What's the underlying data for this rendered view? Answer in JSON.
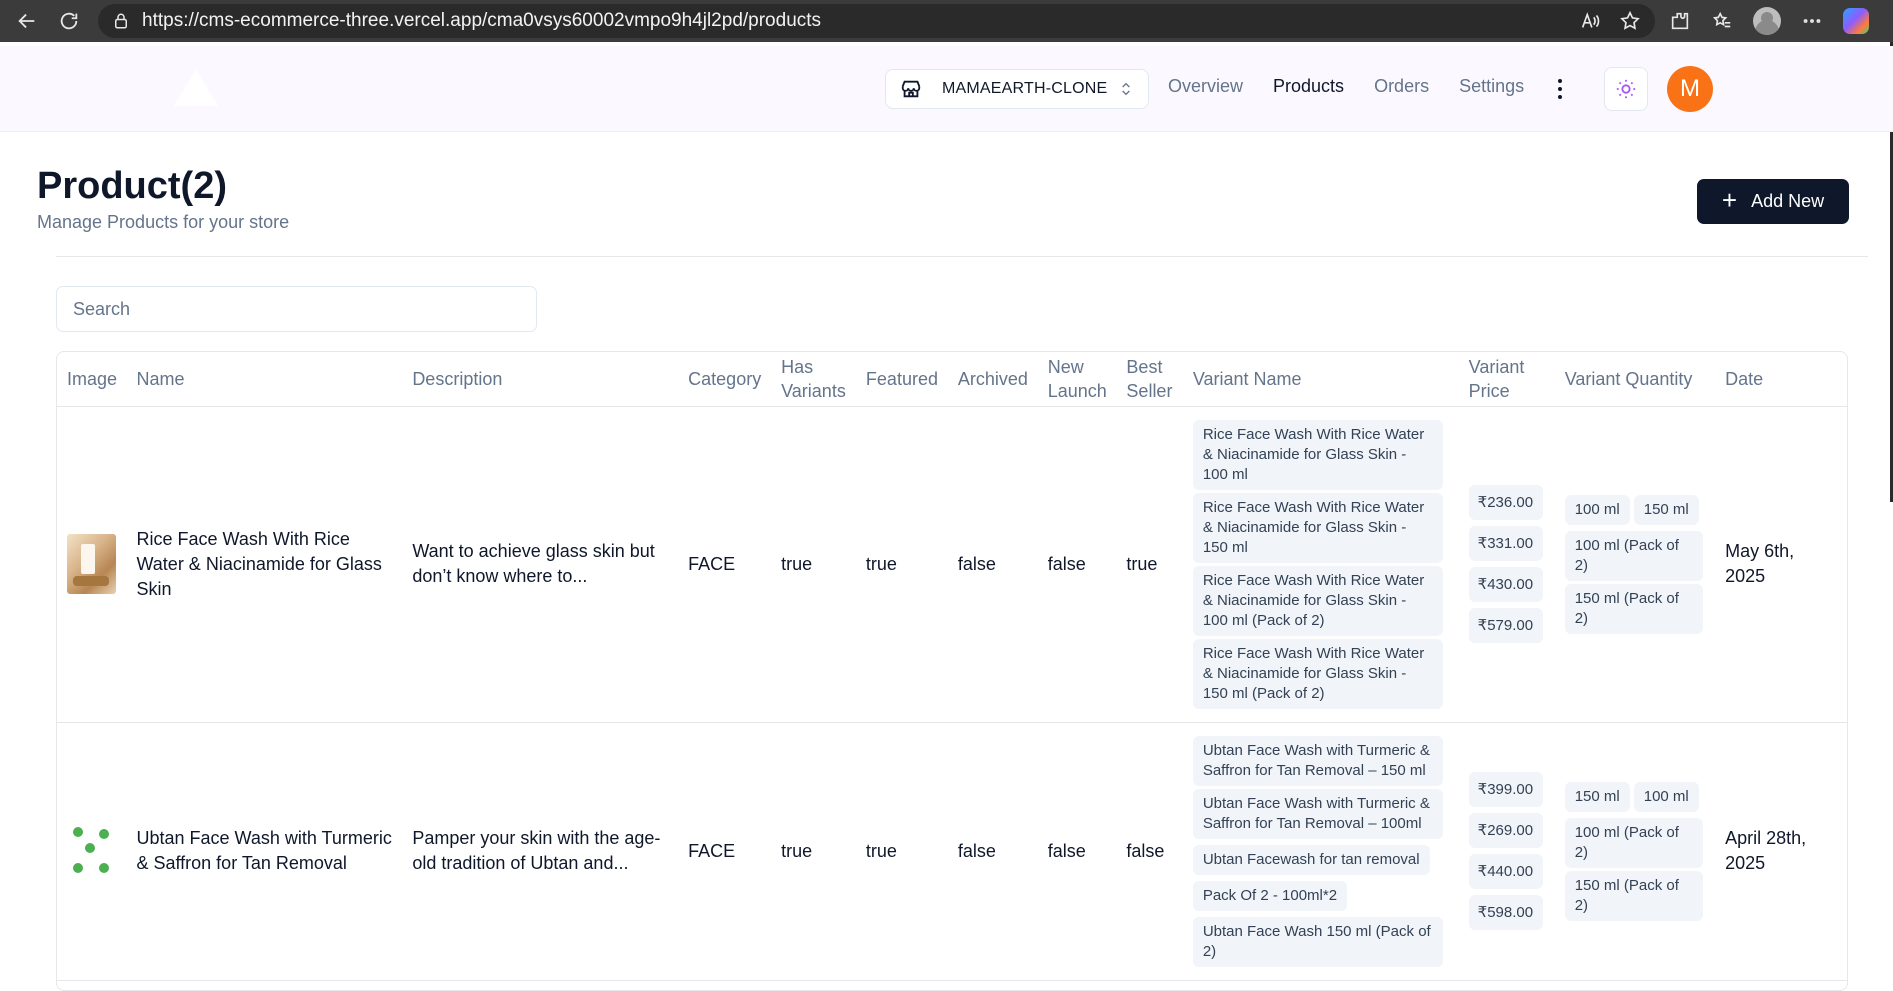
{
  "browser": {
    "url": "https://cms-ecommerce-three.vercel.app/cma0vsys60002vmpo9h4jl2pd/products"
  },
  "header": {
    "store_name": "MAMAEARTH-CLONE",
    "nav": [
      "Overview",
      "Products",
      "Orders",
      "Settings"
    ],
    "active_nav": "Products",
    "avatar_initial": "M",
    "theme_icon": "sun-icon",
    "accent_color": "#f97316"
  },
  "page": {
    "title": "Product(2)",
    "subtitle": "Manage Products for your store",
    "add_button_label": "Add New",
    "search_placeholder": "Search"
  },
  "table": {
    "headers": {
      "image": "Image",
      "name": "Name",
      "description": "Description",
      "category": "Category",
      "has_variants": "Has Variants",
      "featured": "Featured",
      "archived": "Archived",
      "new_launch": "New Launch",
      "best_seller": "Best Seller",
      "variant_name": "Variant Name",
      "variant_price": "Variant Price",
      "variant_quantity": "Variant Quantity",
      "date": "Date"
    },
    "rows": [
      {
        "name": "Rice Face Wash With Rice Water & Niacinamide for Glass Skin",
        "description": "Want to achieve glass skin but don’t know where to...",
        "category": "FACE",
        "has_variants": "true",
        "featured": "true",
        "archived": "false",
        "new_launch": "false",
        "best_seller": "true",
        "variant_names": [
          "Rice Face Wash With Rice Water & Niacinamide for Glass Skin - 100 ml",
          "Rice Face Wash With Rice Water & Niacinamide for Glass Skin - 150 ml",
          "Rice Face Wash With Rice Water & Niacinamide for Glass Skin - 100 ml (Pack of 2)",
          "Rice Face Wash With Rice Water & Niacinamide for Glass Skin - 150 ml (Pack of 2)"
        ],
        "variant_prices": [
          "₹236.00",
          "₹331.00",
          "₹430.00",
          "₹579.00"
        ],
        "variant_quantities": [
          "100 ml",
          "150 ml",
          "100 ml (Pack of 2)",
          "150 ml (Pack of 2)"
        ],
        "date": "May 6th, 2025"
      },
      {
        "name": "Ubtan Face Wash with Turmeric & Saffron for Tan Removal",
        "description": "Pamper your skin with the age-old tradition of Ubtan and...",
        "category": "FACE",
        "has_variants": "true",
        "featured": "true",
        "archived": "false",
        "new_launch": "false",
        "best_seller": "false",
        "variant_names": [
          "Ubtan Face Wash with Turmeric & Saffron for Tan Removal – 150 ml",
          "Ubtan Face Wash with Turmeric & Saffron for Tan Removal – 100ml",
          "Ubtan Facewash for tan removal",
          "Pack Of 2 - 100ml*2",
          "Ubtan Face Wash 150 ml (Pack of 2)"
        ],
        "variant_prices": [
          "₹399.00",
          "₹269.00",
          "₹440.00",
          "₹598.00"
        ],
        "variant_quantities": [
          "150 ml",
          "100 ml",
          "100 ml (Pack of 2)",
          "150 ml (Pack of 2)"
        ],
        "date": "April 28th, 2025"
      }
    ]
  }
}
